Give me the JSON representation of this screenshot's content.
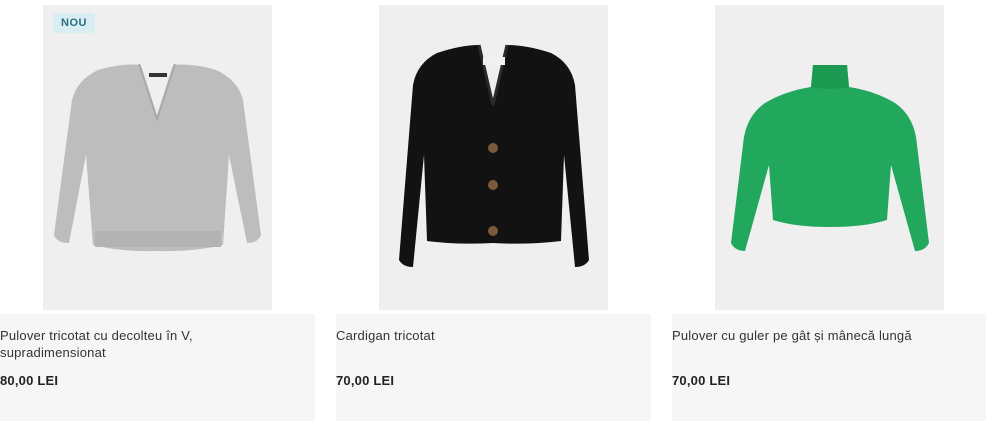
{
  "products": [
    {
      "badge": "NOU",
      "title": "Pulover tricotat cu decolteu în V, supradimensionat",
      "price": "80,00 LEI",
      "image_color": "#b9b9b9",
      "icon": "grey-v-neck-sweater"
    },
    {
      "title": "Cardigan tricotat",
      "price": "70,00 LEI",
      "image_color": "#111111",
      "icon": "black-cardigan"
    },
    {
      "title": "Pulover cu guler pe gât și mânecă lungă",
      "price": "70,00 LEI",
      "image_color": "#1fa85a",
      "icon": "green-turtleneck-sweater"
    }
  ]
}
